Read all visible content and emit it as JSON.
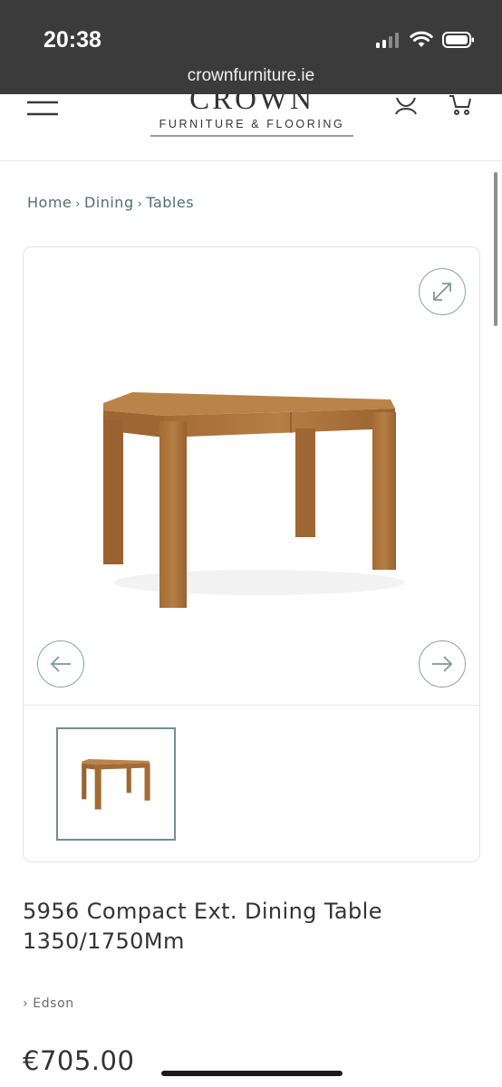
{
  "status_bar": {
    "time": "20:38",
    "url": "crownfurniture.ie",
    "icons": [
      "signal-icon",
      "wifi-icon",
      "battery-icon"
    ]
  },
  "header": {
    "logo_word": "CROWN",
    "logo_sub": "FURNITURE & FLOORING",
    "icons": [
      "menu-icon",
      "account-icon",
      "cart-icon"
    ]
  },
  "breadcrumb": {
    "items": [
      "Home",
      "Dining",
      "Tables"
    ],
    "separator": "›"
  },
  "gallery": {
    "icons": [
      "expand-icon",
      "arrow-left-icon",
      "arrow-right-icon"
    ],
    "thumbnail_count": 1
  },
  "product": {
    "title": "5956 Compact Ext. Dining Table 1350/1750Mm",
    "brand": "› Edson",
    "price": "€705.00"
  },
  "colors": {
    "status_bar_bg": "#3b3b3b",
    "accent_teal": "#4f6f74",
    "wood": "#a8733c"
  }
}
